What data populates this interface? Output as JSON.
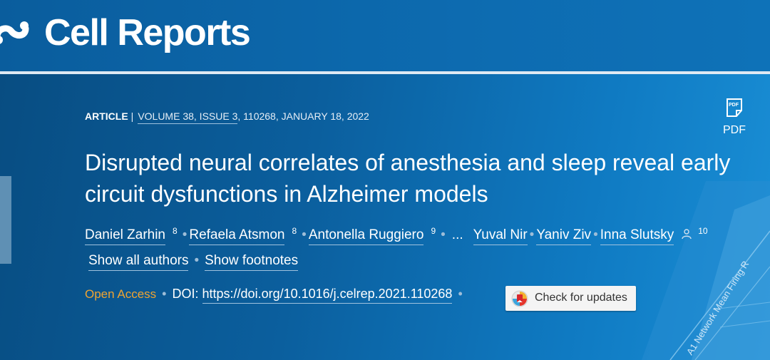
{
  "header": {
    "brand": "Cell Reports",
    "logo_icon": "cell-press-logo-icon"
  },
  "article": {
    "type": "ARTICLE",
    "separator": "|",
    "volume_issue": "VOLUME 38, ISSUE 3",
    "citation_rest": ", 110268, JANUARY 18, 2022",
    "title": "Disrupted neural correlates of anesthesia and sleep reveal early circuit dysfunctions in Alzheimer models"
  },
  "pdf": {
    "label": "PDF",
    "icon": "pdf-icon"
  },
  "authors": {
    "list": [
      {
        "name": "Daniel Zarhin",
        "sup": "8"
      },
      {
        "name": "Refaela Atsmon",
        "sup": "8"
      },
      {
        "name": "Antonella Ruggiero",
        "sup": "9"
      },
      {
        "name": "Yuval Nir"
      },
      {
        "name": "Yaniv Ziv"
      },
      {
        "name": "Inna Slutsky",
        "sup": "10",
        "icon": "person-icon"
      }
    ],
    "ellipsis": "...",
    "show_all": "Show all authors",
    "show_footnotes": "Show footnotes"
  },
  "access": {
    "open_access": "Open Access",
    "doi_label": "DOI:",
    "doi_url": "https://doi.org/10.1016/j.celrep.2021.110268",
    "check_updates": "Check for updates",
    "check_icon": "crossmark-icon"
  },
  "decor": {
    "figure_text": "A1 Network Mean Firing R"
  },
  "colors": {
    "header_bg": "#0a5d9d",
    "open_access": "#f0a431",
    "hero_bg": "#0b5f9e"
  }
}
